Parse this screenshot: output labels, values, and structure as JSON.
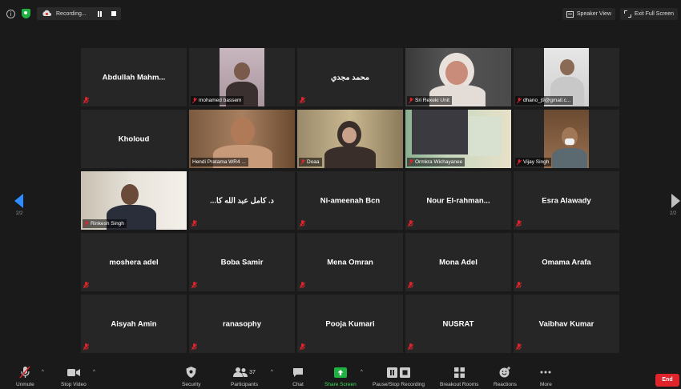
{
  "topbar": {
    "recording_label": "Recording...",
    "speaker_view_label": "Speaker View",
    "exit_full_screen_label": "Exit Full Screen"
  },
  "pagination": {
    "left": "2/2",
    "right": "2/2"
  },
  "participants": [
    {
      "name": "Abdullah  Mahm...",
      "video": false
    },
    {
      "name": "mohamed bassem",
      "video": true
    },
    {
      "name": "محمد مجدي",
      "video": false
    },
    {
      "name": "Sri Rexeki Unit",
      "video": true
    },
    {
      "name": "dhano_j9@gmail.c...",
      "video": true
    },
    {
      "name": "Kholoud",
      "video": false
    },
    {
      "name": "Hendi Pratama WR4 ...",
      "video": true
    },
    {
      "name": "Doaa",
      "video": true
    },
    {
      "name": "Ormkra Wichayanee",
      "video": true
    },
    {
      "name": "Vijay Singh",
      "video": true
    },
    {
      "name": "Rinkesh Singh",
      "video": true
    },
    {
      "name": "...د. كامل عبد الله  كا",
      "video": false
    },
    {
      "name": "Ni-ameenah Bcn",
      "video": false
    },
    {
      "name": "Nour  El-rahman...",
      "video": false
    },
    {
      "name": "Esra Alawady",
      "video": false
    },
    {
      "name": "moshera adel",
      "video": false
    },
    {
      "name": "Boba Samir",
      "video": false
    },
    {
      "name": "Mena Omran",
      "video": false
    },
    {
      "name": "Mona Adel",
      "video": false
    },
    {
      "name": "Omama Arafa",
      "video": false
    },
    {
      "name": "Aisyah Amin",
      "video": false
    },
    {
      "name": "ranasophy",
      "video": false
    },
    {
      "name": "Pooja Kumari",
      "video": false
    },
    {
      "name": "NUSRAT",
      "video": false
    },
    {
      "name": "Vaibhav Kumar",
      "video": false
    }
  ],
  "toolbar": {
    "unmute": "Unmute",
    "stop_video": "Stop Video",
    "security": "Security",
    "participants": "Participants",
    "participants_count": "37",
    "chat": "Chat",
    "share_screen": "Share Screen",
    "pause_stop_recording": "Pause/Stop Recording",
    "breakout_rooms": "Breakout Rooms",
    "reactions": "Reactions",
    "more": "More",
    "end": "End"
  },
  "colors": {
    "accent": "#2d8cff",
    "share_green": "#1fb141",
    "end_red": "#e0242c",
    "muted_red": "#e0242c"
  }
}
